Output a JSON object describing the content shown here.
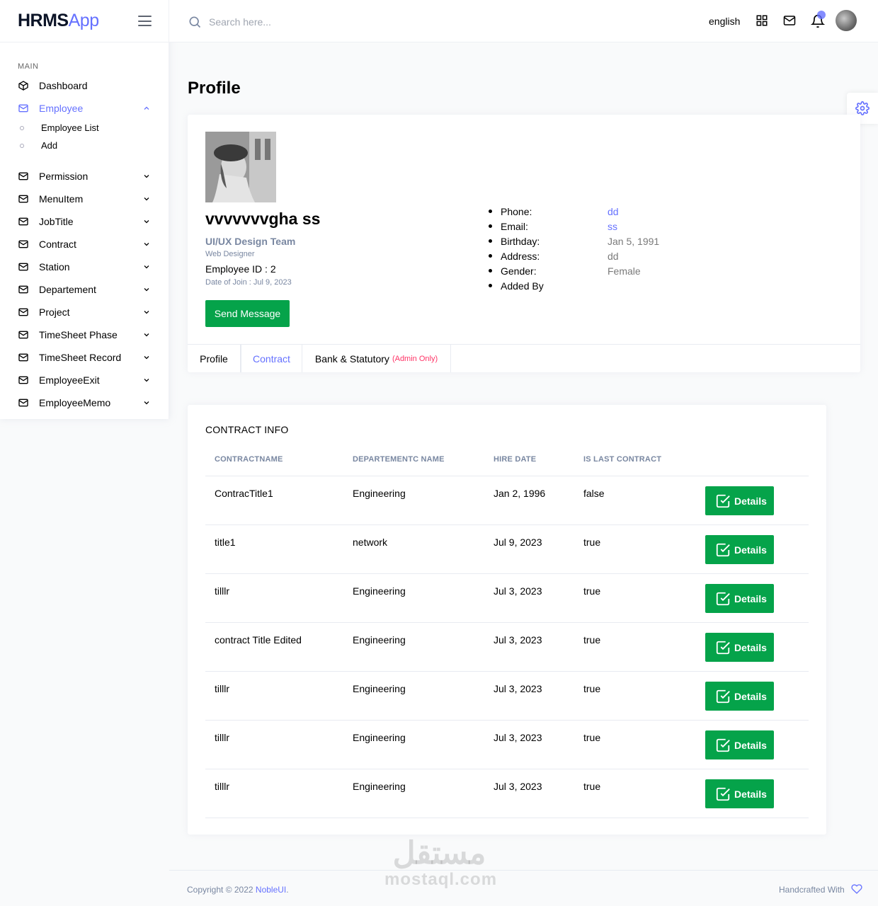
{
  "brand": {
    "part1": "HRMS",
    "part2": "App"
  },
  "colors": {
    "accent": "#6571ff",
    "success": "#05a34a",
    "danger": "#ff3366",
    "muted": "#7987a1"
  },
  "search": {
    "placeholder": "Search here..."
  },
  "topbar": {
    "language": "english",
    "icons": [
      "grid-icon",
      "mail-icon",
      "bell-icon"
    ]
  },
  "sidebar": {
    "category": "MAIN",
    "dashboard": "Dashboard",
    "employee": {
      "label": "Employee",
      "expanded": true,
      "children": [
        "Employee List",
        "Add"
      ]
    },
    "items": [
      "Permission",
      "MenuItem",
      "JobTitle",
      "Contract",
      "Station",
      "Departement",
      "Project",
      "TimeSheet Phase",
      "TimeSheet Record",
      "EmployeeExit",
      "EmployeeMemo"
    ]
  },
  "page": {
    "title": "Profile"
  },
  "profile": {
    "name": "vvvvvvvgha ss",
    "team": "UI/UX Design Team",
    "role": "Web Designer",
    "employee_id": "Employee ID : 2",
    "date_of_join": "Date of Join : Jul 9, 2023",
    "send_message": "Send Message",
    "info": [
      {
        "key": "Phone:",
        "value": "dd"
      },
      {
        "key": "Email:",
        "value": "ss"
      },
      {
        "key": "Birthday:",
        "value": "Jan 5, 1991"
      },
      {
        "key": "Address:",
        "value": "dd"
      },
      {
        "key": "Gender:",
        "value": "Female"
      },
      {
        "key": "Added By",
        "value": ""
      }
    ]
  },
  "tabs": {
    "profile": "Profile",
    "contract": "Contract",
    "bank": "Bank & Statutory",
    "admin_only": "(Admin Only)",
    "active": "Contract"
  },
  "contract": {
    "title": "CONTRACT INFO",
    "columns": [
      "CONTRACTNAME",
      "DEPARTEMENTC NAME",
      "HIRE DATE",
      "IS LAST CONTRACT"
    ],
    "details_label": "Details",
    "rows": [
      {
        "name": "ContracTitle1",
        "dept": "Engineering",
        "hire": "Jan 2, 1996",
        "last": "false"
      },
      {
        "name": "title1",
        "dept": "network",
        "hire": "Jul 9, 2023",
        "last": "true"
      },
      {
        "name": "tilllr",
        "dept": "Engineering",
        "hire": "Jul 3, 2023",
        "last": "true"
      },
      {
        "name": "contract Title Edited",
        "dept": "Engineering",
        "hire": "Jul 3, 2023",
        "last": "true"
      },
      {
        "name": "tilllr",
        "dept": "Engineering",
        "hire": "Jul 3, 2023",
        "last": "true"
      },
      {
        "name": "tilllr",
        "dept": "Engineering",
        "hire": "Jul 3, 2023",
        "last": "true"
      },
      {
        "name": "tilllr",
        "dept": "Engineering",
        "hire": "Jul 3, 2023",
        "last": "true"
      }
    ]
  },
  "footer": {
    "copyright_prefix": "Copyright © 2022 ",
    "copyright_link": "NobleUI",
    "copyright_suffix": ".",
    "handcrafted": "Handcrafted With"
  },
  "watermark": {
    "arabic": "مستقل",
    "latin": "mostaql.com"
  }
}
